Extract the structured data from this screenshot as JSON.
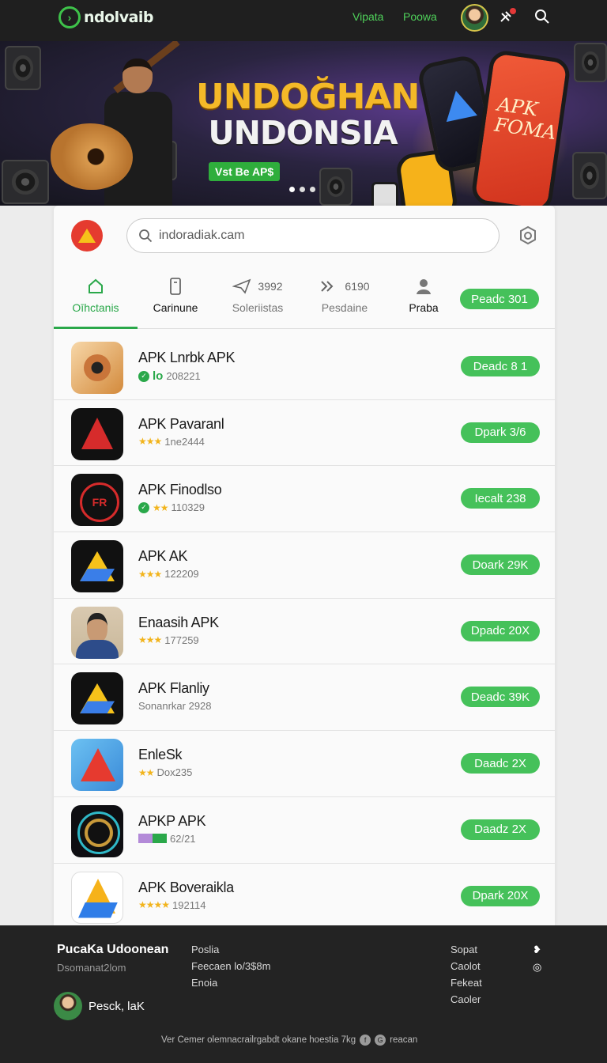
{
  "header": {
    "logo_text": "ndolvaib",
    "nav": [
      "Vipata",
      "Poowa"
    ],
    "icons": [
      "tools-icon",
      "search-icon"
    ]
  },
  "hero": {
    "title_line1": "UNDOĞHAN",
    "title_line2": "UNDONSIA",
    "cta": "Vst Be AP$",
    "phone_text": "APK\nFOMA",
    "slide_count": 3,
    "active_slide": 1
  },
  "search": {
    "placeholder": "indoradiak.cam"
  },
  "tabs": [
    {
      "label": "Oīhctanis",
      "icon": "home-icon",
      "active": true
    },
    {
      "label": "Carinune",
      "icon": "phone-icon"
    },
    {
      "label": "Soleriistas",
      "icon": "send-icon",
      "count": "3992"
    },
    {
      "label": "Pesdaine",
      "icon": "chevrons-icon",
      "count": "6190"
    },
    {
      "label": "Praba",
      "icon": "user-icon"
    }
  ],
  "tab_action": "Peadc 301",
  "apps": [
    {
      "name": "APK Lnrbk APK",
      "meta": "208221",
      "badge": "lo",
      "rating_style": "check",
      "button": "Deadc 8 1",
      "icon": "wood-icon"
    },
    {
      "name": "APK Pavaranl",
      "meta": "1ne2444",
      "rating_style": "stars",
      "button": "Dpark 3/6",
      "icon": "red-a-icon"
    },
    {
      "name": "APK Finodlso",
      "meta": "110329",
      "rating_style": "check-stars",
      "button": "Iecalt 238",
      "icon": "fr-ring-icon"
    },
    {
      "name": "APK AK",
      "meta": "122209",
      "rating_style": "stars",
      "button": "Doark 29K",
      "icon": "drive-icon"
    },
    {
      "name": "Enaasih APK",
      "meta": "177259",
      "rating_style": "stars",
      "button": "Dpadc 20X",
      "icon": "person-icon"
    },
    {
      "name": "APK Flanliy",
      "meta": "Sonanrkar 2928",
      "rating_style": "none",
      "button": "Deadc 39K",
      "icon": "drive-dark-icon"
    },
    {
      "name": "EnleSk",
      "meta": "Dox235",
      "rating_style": "stars",
      "button": "Daadc 2X",
      "icon": "blue-a-icon"
    },
    {
      "name": "APKP APK",
      "meta": "62/21",
      "rating_style": "badge",
      "button": "Daadz 2X",
      "icon": "disc-icon"
    },
    {
      "name": "APK Boveraikla",
      "meta": "192114",
      "rating_style": "stars",
      "button": "Dpark 20X",
      "icon": "google-icon"
    }
  ],
  "footer": {
    "title": "PucaKa Udoonean",
    "subtitle": "Dsomanat2lom",
    "col1": [
      "Poslia",
      "Feecaen lo/3$8m",
      "Enoia"
    ],
    "col2": [
      "Sopat",
      "Caolot",
      "Fekeat",
      "Caoler"
    ],
    "user_name": "Pesck, laK",
    "bottom_text": "Ver Cemer olemnacrailrgabdt okane hoestia 7kg",
    "bottom_link": "reacan"
  }
}
